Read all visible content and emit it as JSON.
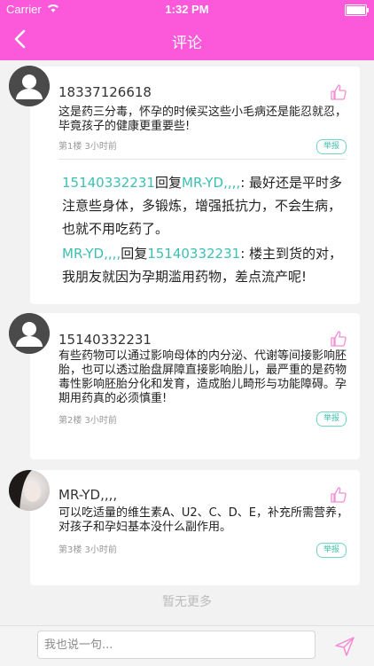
{
  "status_bar": {
    "carrier": "Carrier",
    "time": "1:32 PM"
  },
  "nav": {
    "title": "评论"
  },
  "comments": [
    {
      "username": "18337126618",
      "text": "这是药三分毒，怀孕的时候买这些小毛病还是能忍就忍，毕竟孩子的健康更重要些!",
      "meta": "第1楼 3小时前",
      "report": "举报",
      "replies": [
        {
          "from": "15140332231",
          "verb": "回复",
          "to": "MR-YD,,,,",
          "text": ": 最好还是平时多注意些身体，多锻炼，增强抵抗力，不会生病，也就不用吃药了。"
        },
        {
          "from": "MR-YD,,,,",
          "verb": "回复",
          "to": "15140332231",
          "text": ": 楼主到货的对，我朋友就因为孕期滥用药物，差点流产呢!"
        }
      ]
    },
    {
      "username": "15140332231",
      "text": "有些药物可以通过影响母体的内分泌、代谢等间接影响胚胎，也可以透过胎盘屏障直接影响胎儿，最严重的是药物毒性影响胚胎分化和发育，造成胎儿畸形与功能障碍。孕期用药真的必须慎重!",
      "meta": "第2楼 3小时前",
      "report": "举报"
    },
    {
      "username": "MR-YD,,,,",
      "text": "可以吃适量的维生素A、U2、C、D、E，补充所需营养，对孩子和孕妇基本没什么副作用。",
      "meta": "第3楼 3小时前",
      "report": "举报"
    }
  ],
  "no_more": "暂无更多",
  "input": {
    "placeholder": "我也说一句..."
  },
  "colors": {
    "brand": "#fb59d9",
    "accent": "#3cc0b4",
    "like": "#f58bd4"
  }
}
